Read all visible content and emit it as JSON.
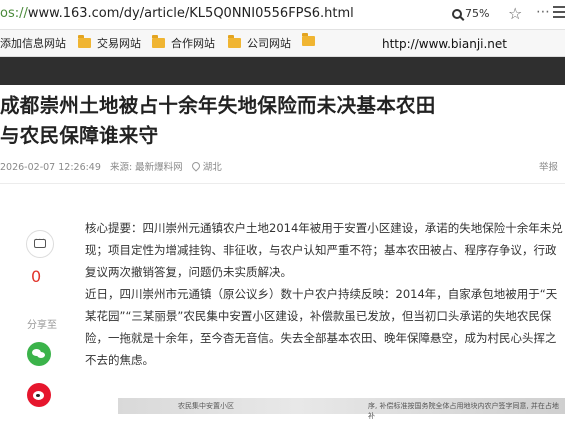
{
  "browser": {
    "url_scheme": "os://",
    "url_rest": "www.163.com/dy/article/KL5Q0NNI0556FPS6.html",
    "zoom": "75%",
    "bookmarks": [
      "添加信息网站",
      "交易网站",
      "合作网站",
      "公司网站",
      ""
    ],
    "site_label": "http://www.bianji.net"
  },
  "article": {
    "title_line1": "成都崇州土地被占十余年失地保险而未决基本农田",
    "title_line2": "与农民保障谁来守",
    "time": "2026-02-07 12:26:49",
    "source": "来源: 最新爆料网",
    "location": "湖北",
    "report": "举报",
    "paragraph1": "核心提要：四川崇州元通镇农户土地2014年被用于安置小区建设，承诺的失地保险十余年未兑现；项目定性为增减挂钩、非征收，与农户认知严重不符；基本农田被占、程序存争议，行政复议两次撤销答复，问题仍未实质解决。",
    "paragraph2": "近日，四川崇州市元通镇（原公议乡）数十户农户持续反映：2014年，自家承包地被用于“天某花园”“三某丽景”农民集中安置小区建设，补偿款虽已发放，但当初口头承诺的失地农民保险，一拖就是十余年，至今杳无音信。失去全部基本农田、晚年保障悬空，成为村民心头挥之不去的焦虑。"
  },
  "share": {
    "comment_count": "0",
    "share_label": "分享至"
  },
  "photo": {
    "caption_left": "农民集中安置小区",
    "caption_right": "序, 补偿标准按国务院全体占用地块内农户签字同意, 并在占地补"
  }
}
